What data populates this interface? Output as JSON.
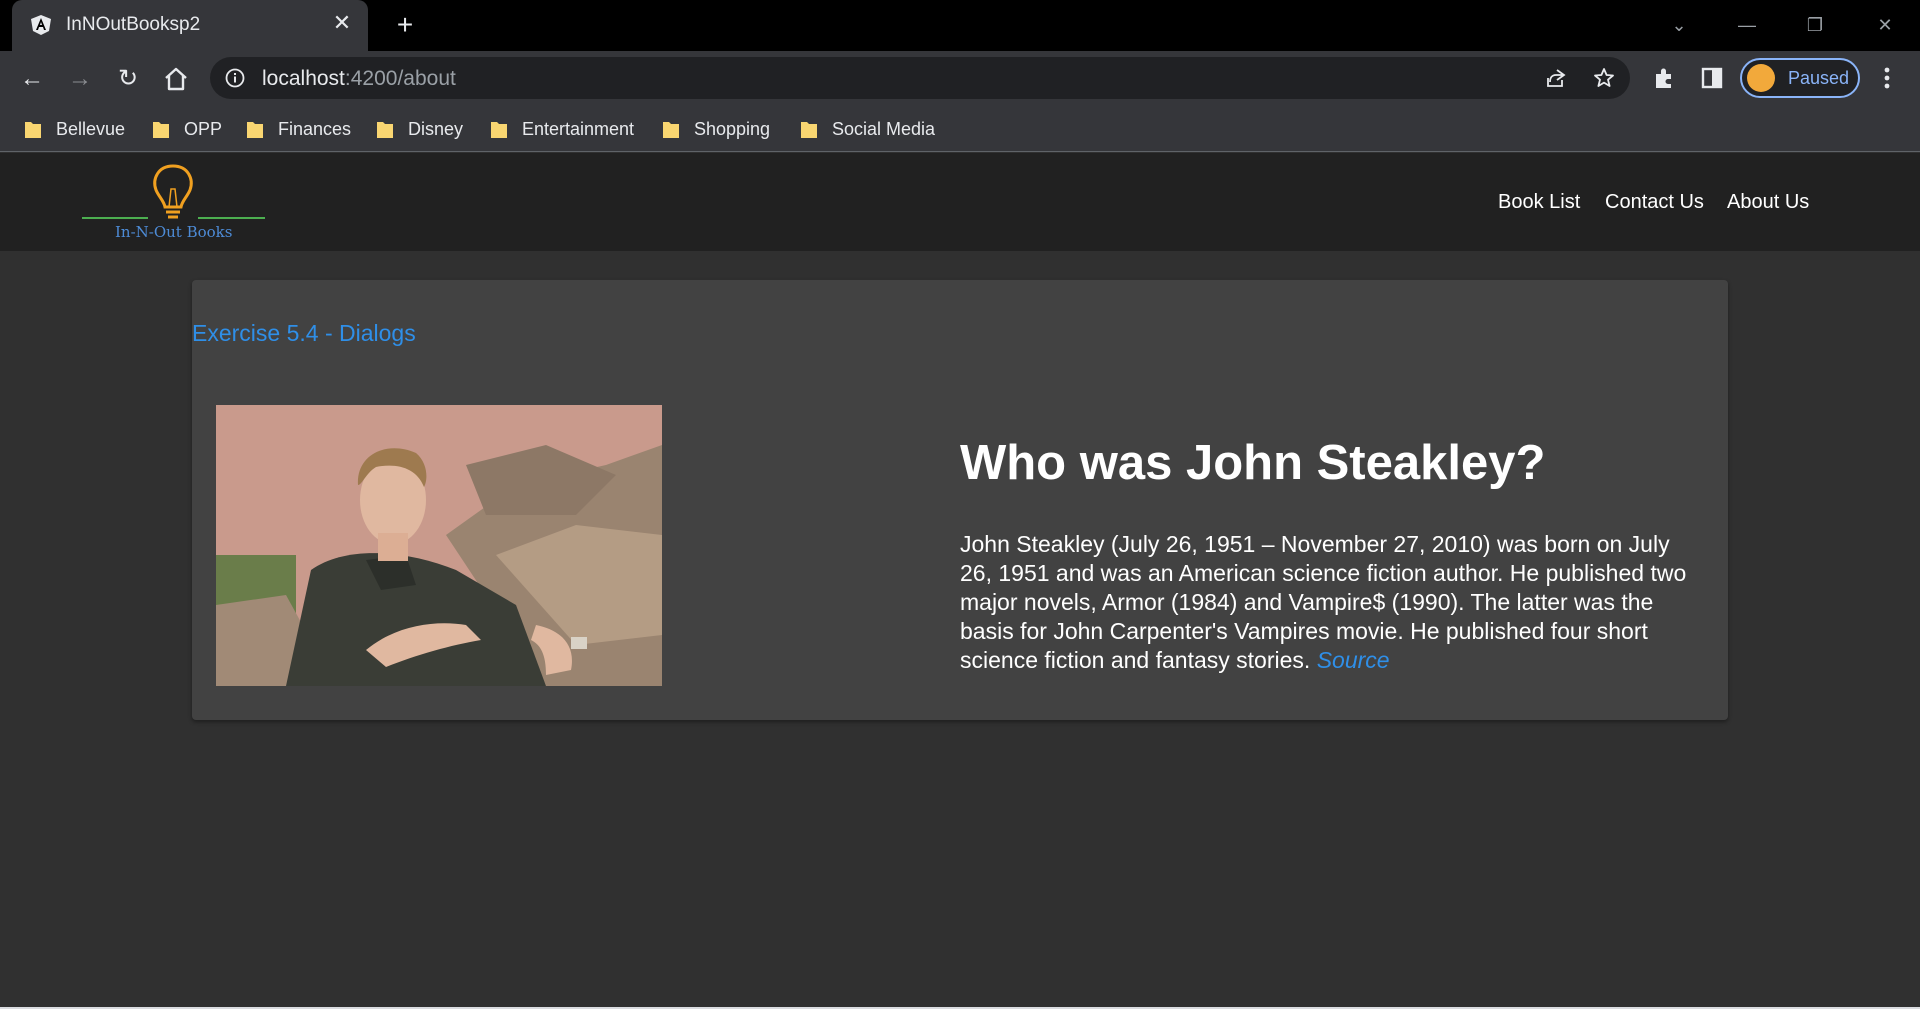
{
  "browser": {
    "tab_title": "InNOutBooksp2",
    "url_host": "localhost",
    "url_rest": ":4200/about",
    "profile_label": "Paused",
    "bookmarks": [
      "Bellevue",
      "OPP",
      "Finances",
      "Disney",
      "Entertainment",
      "Shopping",
      "Social Media"
    ]
  },
  "app": {
    "logo_text": "In-N-Out Books",
    "nav": [
      "Book List",
      "Contact Us",
      "About Us"
    ]
  },
  "about": {
    "exercise_title": "Exercise 5.4 - Dialogs",
    "heading": "Who was John Steakley?",
    "bio": "John Steakley (July 26, 1951 – November 27, 2010) was born on July 26, 1951 and was an American science fiction author. He published two major novels, Armor (1984) and Vampire$ (1990). The latter was the basis for John Carpenter's Vampires movie. He published four short science fiction and fantasy stories.",
    "source_link": "Source"
  },
  "colors": {
    "accent": "#2f8fe8",
    "header_bg": "#212121",
    "card_bg": "#424242",
    "page_bg": "#303030"
  }
}
